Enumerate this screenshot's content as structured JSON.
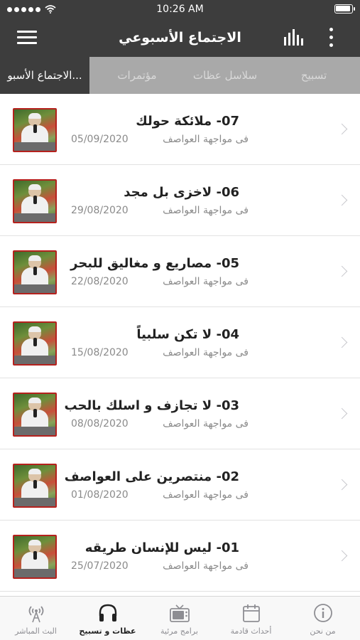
{
  "status_bar": {
    "time": "10:26 AM"
  },
  "navbar": {
    "title": "الاجتماع الأسبوعي"
  },
  "tabs": [
    {
      "label": "الاجتماع الأسبو...",
      "active": true
    },
    {
      "label": "مؤتمرات",
      "active": false
    },
    {
      "label": "سلاسل عظات",
      "active": false
    },
    {
      "label": "تسبيح",
      "active": false
    }
  ],
  "episodes": [
    {
      "title": "07- ملائكة حولك",
      "series": "فى مواجهة العواصف",
      "date": "05/09/2020"
    },
    {
      "title": "06- لاخزى بل مجد",
      "series": "فى مواجهة العواصف",
      "date": "29/08/2020"
    },
    {
      "title": "05- مصاريع و مغاليق للبحر",
      "series": "فى مواجهة العواصف",
      "date": "22/08/2020"
    },
    {
      "title": "04- لا تكن سلبياً",
      "series": "فى مواجهة العواصف",
      "date": "15/08/2020"
    },
    {
      "title": "03- لا تجازف و اسلك بالحب",
      "series": "فى مواجهة العواصف",
      "date": "08/08/2020"
    },
    {
      "title": "02- منتصرين على العواصف",
      "series": "فى مواجهة العواصف",
      "date": "01/08/2020"
    },
    {
      "title": "01- ليس للإنسان طريقه",
      "series": "فى مواجهة العواصف",
      "date": "25/07/2020"
    }
  ],
  "tabbar": [
    {
      "label": "البث المباشر",
      "icon": "broadcast-icon",
      "active": false
    },
    {
      "label": "عظات و تسبيح",
      "icon": "headphones-icon",
      "active": true
    },
    {
      "label": "برامج مرئية",
      "icon": "tv-icon",
      "active": false
    },
    {
      "label": "أحداث قادمة",
      "icon": "calendar-icon",
      "active": false
    },
    {
      "label": "من نحن",
      "icon": "info-icon",
      "active": false
    }
  ]
}
